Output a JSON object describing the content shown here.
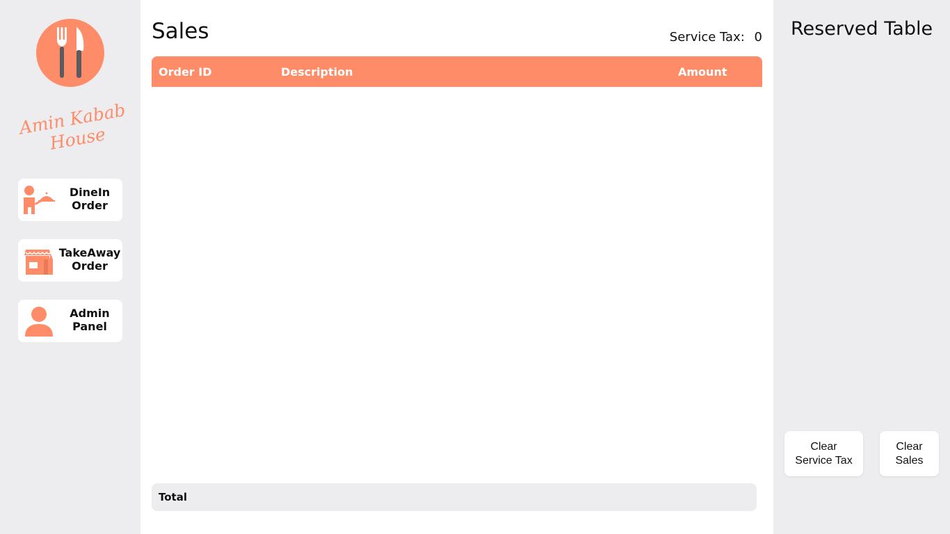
{
  "brand": {
    "name_line1": "Amin Kabab",
    "name_line2": "House",
    "accent_color": "#ff8c69",
    "logo_icon": "fork-knife-icon"
  },
  "sidebar": {
    "items": [
      {
        "line1": "DineIn",
        "line2": "Order",
        "icon": "waiter-cloche-icon"
      },
      {
        "line1": "TakeAway",
        "line2": "Order",
        "icon": "shop-icon"
      },
      {
        "line1": "Admin",
        "line2": "Panel",
        "icon": "user-icon"
      }
    ]
  },
  "main": {
    "title": "Sales",
    "service_tax_label": "Service Tax:",
    "service_tax_value": "0",
    "table": {
      "columns": [
        "Order ID",
        "Description",
        "Amount"
      ],
      "rows": []
    },
    "total_label": "Total"
  },
  "right_panel": {
    "title": "Reserved Table",
    "clear_service_tax": {
      "line1": "Clear",
      "line2": "Service Tax"
    },
    "clear_sales": {
      "line1": "Clear",
      "line2": "Sales"
    }
  }
}
